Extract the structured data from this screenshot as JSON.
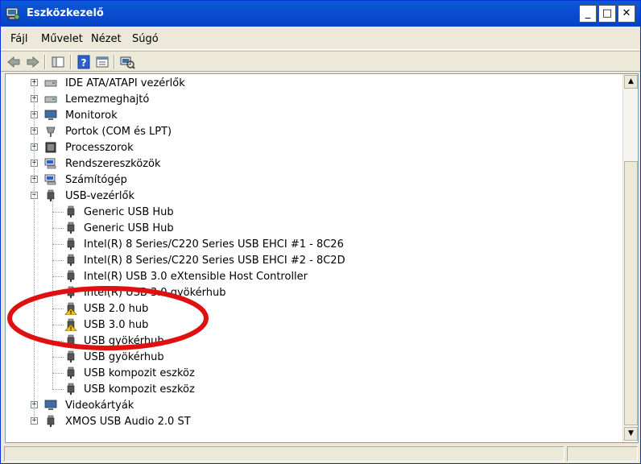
{
  "window": {
    "title": "Eszközkezelő",
    "min_glyph": "_",
    "max_glyph": "□",
    "close_glyph": "✕"
  },
  "menu": [
    "Fájl",
    "Művelet",
    "Nézet",
    "Súgó"
  ],
  "tree": {
    "categories_top": [
      {
        "label": "IDE ATA/ATAPI vezérlők",
        "icon": "ide-controller-icon"
      },
      {
        "label": "Lemezmeghajtó",
        "icon": "disk-drive-icon"
      },
      {
        "label": "Monitorok",
        "icon": "monitor-icon"
      },
      {
        "label": "Portok (COM és LPT)",
        "icon": "port-icon"
      },
      {
        "label": "Processzorok",
        "icon": "processor-icon"
      },
      {
        "label": "Rendszereszközök",
        "icon": "system-devices-icon"
      },
      {
        "label": "Számítógép",
        "icon": "computer-icon"
      }
    ],
    "usb_category": {
      "label": "USB-vezérlők",
      "icon": "usb-controller-icon",
      "expanded": true
    },
    "usb_children": [
      {
        "label": "Generic USB Hub",
        "warning": false
      },
      {
        "label": "Generic USB Hub",
        "warning": false
      },
      {
        "label": "Intel(R) 8 Series/C220 Series USB EHCI #1 - 8C26",
        "warning": false
      },
      {
        "label": "Intel(R) 8 Series/C220 Series USB EHCI #2 - 8C2D",
        "warning": false
      },
      {
        "label": "Intel(R) USB 3.0 eXtensible Host Controller",
        "warning": false
      },
      {
        "label": "Intel(R) USB 3.0 gyökérhub",
        "warning": false
      },
      {
        "label": "USB 2.0 hub",
        "warning": true
      },
      {
        "label": "USB 3.0 hub",
        "warning": true
      },
      {
        "label": "USB gyökérhub",
        "warning": false
      },
      {
        "label": "USB gyökérhub",
        "warning": false
      },
      {
        "label": "USB kompozit eszköz",
        "warning": false
      },
      {
        "label": "USB kompozit eszköz",
        "warning": false
      }
    ],
    "categories_bottom": [
      {
        "label": "Videokártyák",
        "icon": "display-adapter-icon"
      },
      {
        "label": "XMOS USB Audio 2.0 ST",
        "icon": "usb-audio-icon"
      }
    ]
  },
  "colors": {
    "titlebar": "#0a5bd8",
    "annotation": "#e01010",
    "warning": "#f5c400"
  }
}
